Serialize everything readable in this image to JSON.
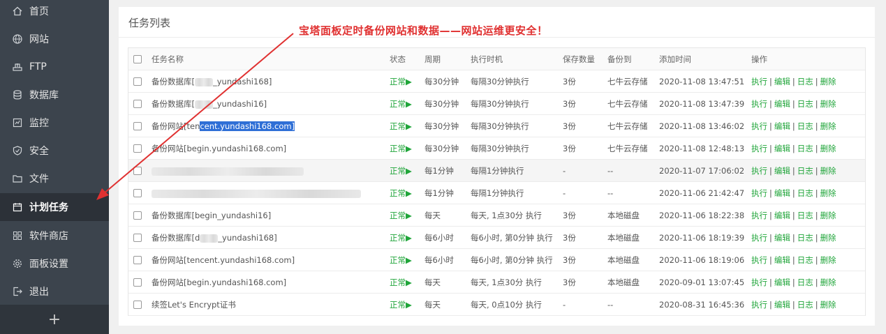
{
  "sidebar": {
    "items": [
      {
        "label": "首页",
        "icon": "home-icon"
      },
      {
        "label": "网站",
        "icon": "globe-icon"
      },
      {
        "label": "FTP",
        "icon": "ftp-icon"
      },
      {
        "label": "数据库",
        "icon": "database-icon"
      },
      {
        "label": "监控",
        "icon": "monitor-icon"
      },
      {
        "label": "安全",
        "icon": "shield-icon"
      },
      {
        "label": "文件",
        "icon": "folder-icon"
      },
      {
        "label": "计划任务",
        "icon": "calendar-icon",
        "active": true
      },
      {
        "label": "软件商店",
        "icon": "apps-icon"
      },
      {
        "label": "面板设置",
        "icon": "gear-icon"
      },
      {
        "label": "退出",
        "icon": "logout-icon"
      }
    ],
    "add_label": "+"
  },
  "panel": {
    "title": "任务列表",
    "banner": "宝塔面板定时备份网站和数据——网站运维更安全！"
  },
  "table": {
    "headers": {
      "name": "任务名称",
      "status": "状态",
      "cycle": "周期",
      "exec": "执行时机",
      "keep": "保存数量",
      "dest": "备份到",
      "time": "添加时间",
      "ops": "操作"
    },
    "ops_labels": {
      "run": "执行",
      "edit": "编辑",
      "log": "日志",
      "del": "删除"
    },
    "rows": [
      {
        "name_pre": "备份数据库[",
        "name_post": "_yundashi168]",
        "status": "正常▶",
        "cycle": "每30分钟",
        "exec": "每隔30分钟执行",
        "keep": "3份",
        "dest": "七牛云存储",
        "time": "2020-11-08 13:47:51"
      },
      {
        "name_pre": "备份数据库[",
        "name_post": "_yundashi16]",
        "status": "正常▶",
        "cycle": "每30分钟",
        "exec": "每隔30分钟执行",
        "keep": "3份",
        "dest": "七牛云存储",
        "time": "2020-11-08 13:47:39"
      },
      {
        "name_pre": "备份网站[ten",
        "name_hl": "cent.yundashi168.com]",
        "status": "正常▶",
        "cycle": "每30分钟",
        "exec": "每隔30分钟执行",
        "keep": "3份",
        "dest": "七牛云存储",
        "time": "2020-11-08 13:46:02"
      },
      {
        "name": "备份网站[begin.yundashi168.com]",
        "status": "正常▶",
        "cycle": "每30分钟",
        "exec": "每隔30分钟执行",
        "keep": "3份",
        "dest": "七牛云存储",
        "time": "2020-11-08 12:48:13"
      },
      {
        "name": "",
        "status": "正常▶",
        "cycle": "每1分钟",
        "exec": "每隔1分钟执行",
        "keep": "-",
        "dest": "--",
        "time": "2020-11-07 17:06:02"
      },
      {
        "name": "",
        "status": "正常▶",
        "cycle": "每1分钟",
        "exec": "每隔1分钟执行",
        "keep": "-",
        "dest": "--",
        "time": "2020-11-06 21:42:47"
      },
      {
        "name": "备份数据库[begin_yundashi16]",
        "status": "正常▶",
        "cycle": "每天",
        "exec": "每天, 1点30分 执行",
        "keep": "3份",
        "dest": "本地磁盘",
        "time": "2020-11-06 18:22:38"
      },
      {
        "name_pre": "备份数据库[d",
        "name_post": "_yundashi168]",
        "status": "正常▶",
        "cycle": "每6小时",
        "exec": "每6小时, 第0分钟 执行",
        "keep": "3份",
        "dest": "本地磁盘",
        "time": "2020-11-06 18:19:39"
      },
      {
        "name": "备份网站[tencent.yundashi168.com]",
        "status": "正常▶",
        "cycle": "每6小时",
        "exec": "每6小时, 第0分钟 执行",
        "keep": "3份",
        "dest": "本地磁盘",
        "time": "2020-11-06 18:19:06"
      },
      {
        "name": "备份网站[begin.yundashi168.com]",
        "status": "正常▶",
        "cycle": "每天",
        "exec": "每天, 1点30分 执行",
        "keep": "3份",
        "dest": "本地磁盘",
        "time": "2020-09-01 13:07:45"
      },
      {
        "name": "续签Let's Encrypt证书",
        "status": "正常▶",
        "cycle": "每天",
        "exec": "每天, 0点10分 执行",
        "keep": "-",
        "dest": "--",
        "time": "2020-08-31 16:45:36"
      }
    ]
  },
  "colors": {
    "sidebar_bg": "#3c444d",
    "active_bg": "#2c3138",
    "accent_green": "#20a53a",
    "banner_red": "#e03131",
    "selection_blue": "#2f6fd6"
  }
}
